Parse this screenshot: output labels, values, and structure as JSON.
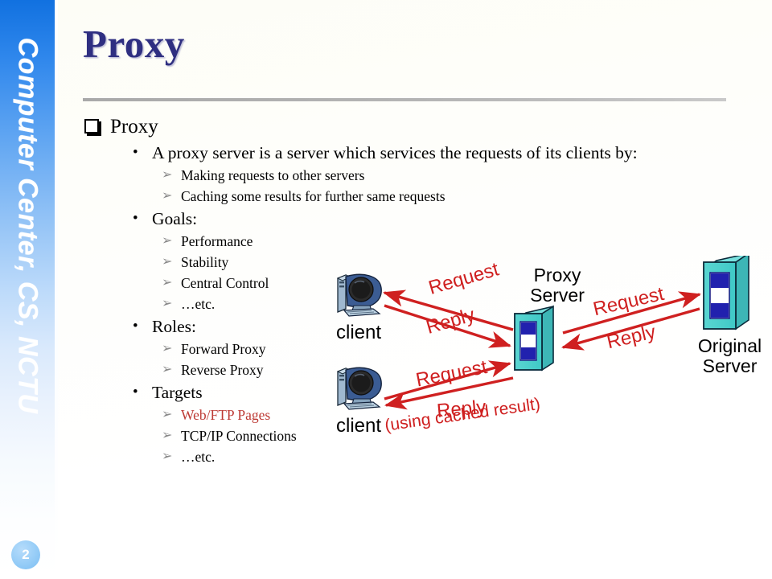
{
  "sidebar": {
    "vertical_text": "Computer Center, CS, NCTU",
    "page_number": "2"
  },
  "slide": {
    "title": "Proxy"
  },
  "outline": {
    "heading": "Proxy",
    "items": [
      {
        "level": 2,
        "marker": "•",
        "text": "A proxy server is a server which services the requests of its clients by:"
      },
      {
        "level": 3,
        "marker": "➢",
        "text": "Making requests to other servers"
      },
      {
        "level": 3,
        "marker": "➢",
        "text": "Caching some results for further same requests"
      },
      {
        "level": 2,
        "marker": "•",
        "text": "Goals:"
      },
      {
        "level": 3,
        "marker": "➢",
        "text": "Performance"
      },
      {
        "level": 3,
        "marker": "➢",
        "text": "Stability"
      },
      {
        "level": 3,
        "marker": "➢",
        "text": "Central Control"
      },
      {
        "level": 3,
        "marker": "➢",
        "text": "…etc."
      },
      {
        "level": 2,
        "marker": "•",
        "text": "Roles:"
      },
      {
        "level": 3,
        "marker": "➢",
        "text": "Forward Proxy"
      },
      {
        "level": 3,
        "marker": "➢",
        "text": "Reverse Proxy"
      },
      {
        "level": 2,
        "marker": "•",
        "text": "Targets"
      },
      {
        "level": 3,
        "marker": "➢",
        "text": "Web/FTP Pages",
        "color": "#bd3a34"
      },
      {
        "level": 3,
        "marker": "➢",
        "text": "TCP/IP Connections"
      },
      {
        "level": 3,
        "marker": "➢",
        "text": "…etc."
      }
    ]
  },
  "diagram": {
    "nodes": {
      "client_top": "client",
      "client_bottom": "client",
      "proxy_server": "Proxy\nServer",
      "proxy_server_line1": "Proxy",
      "proxy_server_line2": "Server",
      "original_server_line1": "Original",
      "original_server_line2": "Server"
    },
    "arrows": {
      "client_top_request": "Request",
      "client_top_reply": "Reply",
      "client_bottom_request": "Request",
      "client_bottom_reply": "Reply",
      "client_bottom_reply_note": "(using cached result)",
      "origin_request": "Request",
      "origin_reply": "Reply"
    },
    "colors": {
      "arrow": "#cf2020",
      "server_body": "#4fd0cd",
      "server_band": "#2222b0",
      "title_blue": "#2f2f81",
      "accent_red": "#bd3a34"
    }
  }
}
